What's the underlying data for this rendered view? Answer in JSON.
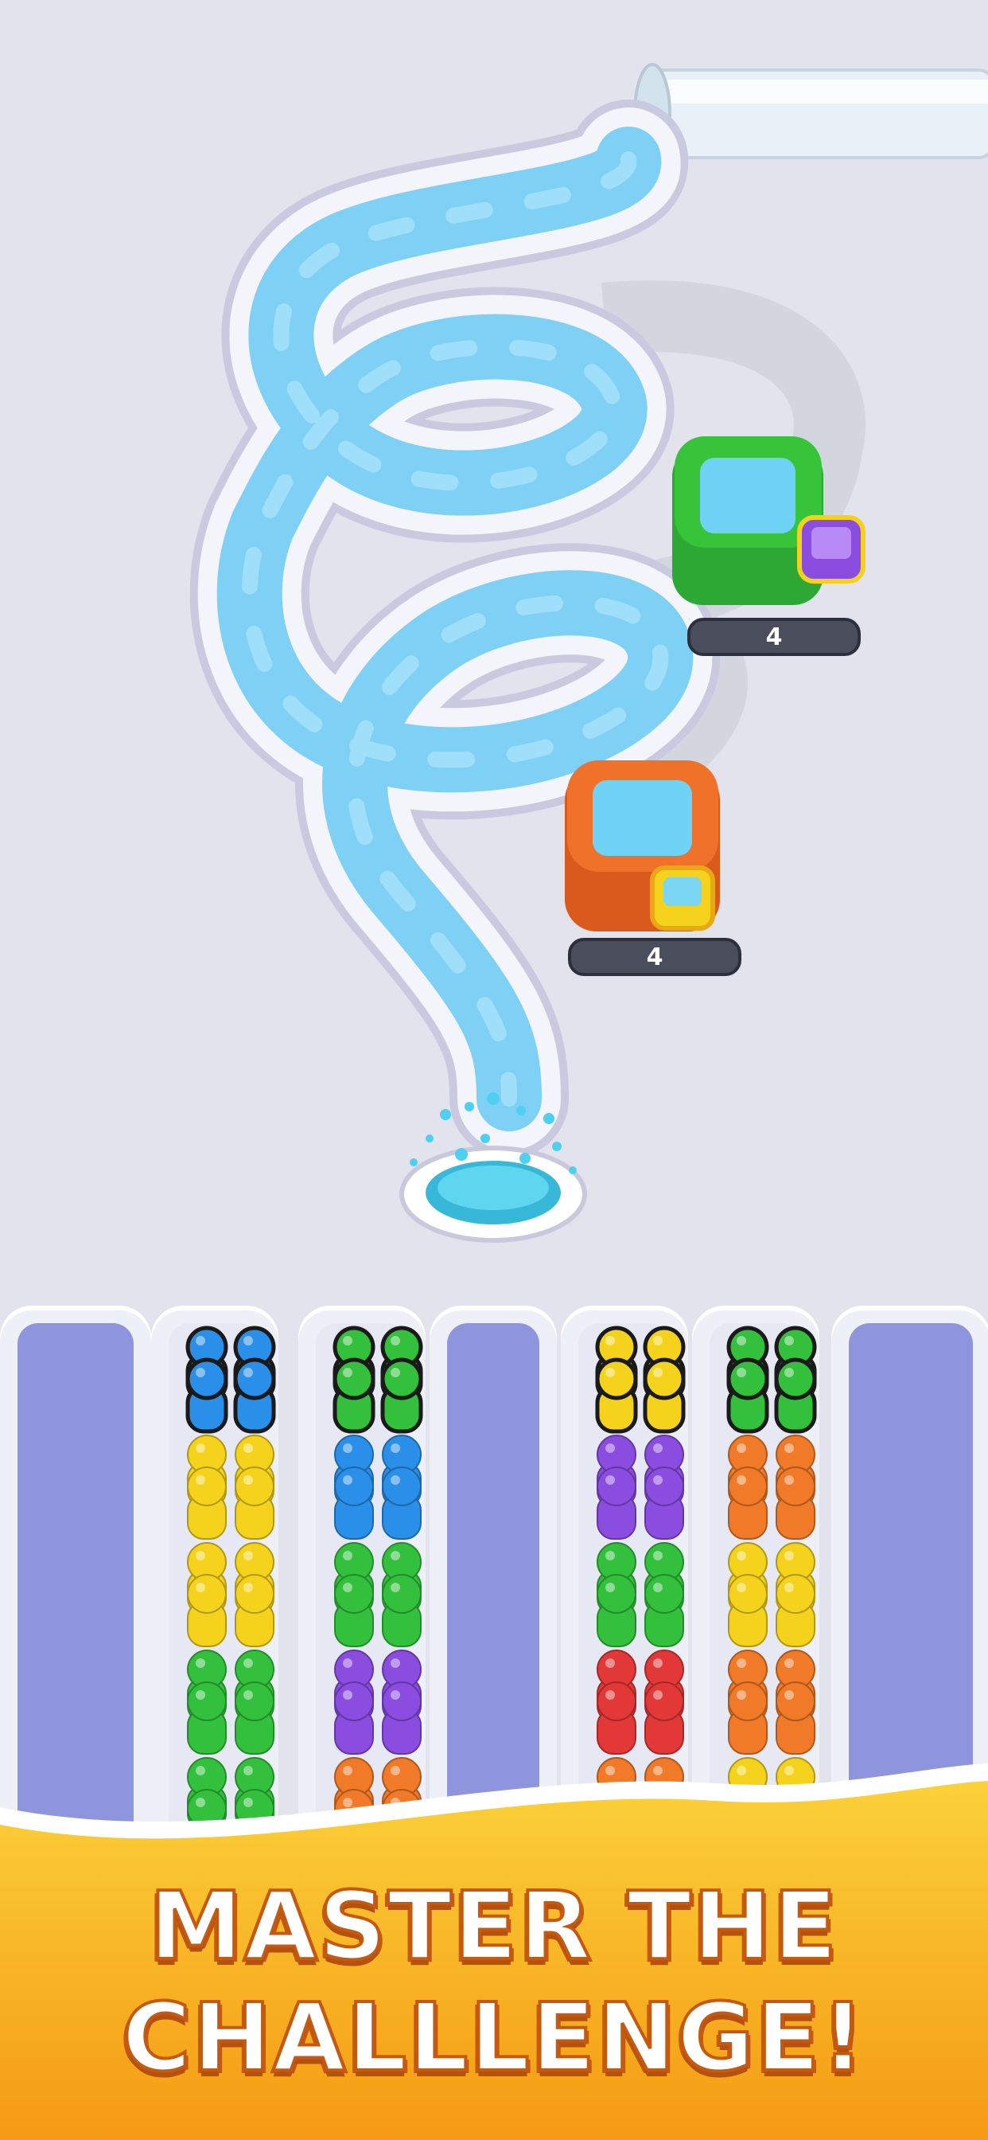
{
  "banner": {
    "line1": "MASTER THE",
    "line2": "CHALLLENGE!"
  },
  "buckets": [
    {
      "color": "#38c43a",
      "count": "4",
      "badge_color": "#8a4de0"
    },
    {
      "color": "#f0722a",
      "count": "4",
      "badge_color": "#f5d31d"
    }
  ],
  "colors": {
    "blue": "#2a8fe8",
    "yellow": "#f5d31d",
    "green": "#33c03c",
    "purple": "#8a4de0",
    "orange": "#f07a28",
    "red": "#e23838",
    "water": "#7fd0f5",
    "banner": "#f8b21c"
  },
  "columns": [
    {
      "type": "empty"
    },
    {
      "type": "full",
      "groups": [
        "blue",
        "yellow",
        "yellow",
        "green",
        "green"
      ]
    },
    {
      "type": "full",
      "groups": [
        "green",
        "blue",
        "green",
        "purple",
        "orange"
      ]
    },
    {
      "type": "empty"
    },
    {
      "type": "full",
      "groups": [
        "yellow",
        "purple",
        "green",
        "red",
        "orange"
      ]
    },
    {
      "type": "full",
      "groups": [
        "green",
        "orange",
        "yellow",
        "orange",
        "yellow"
      ]
    },
    {
      "type": "empty"
    }
  ]
}
